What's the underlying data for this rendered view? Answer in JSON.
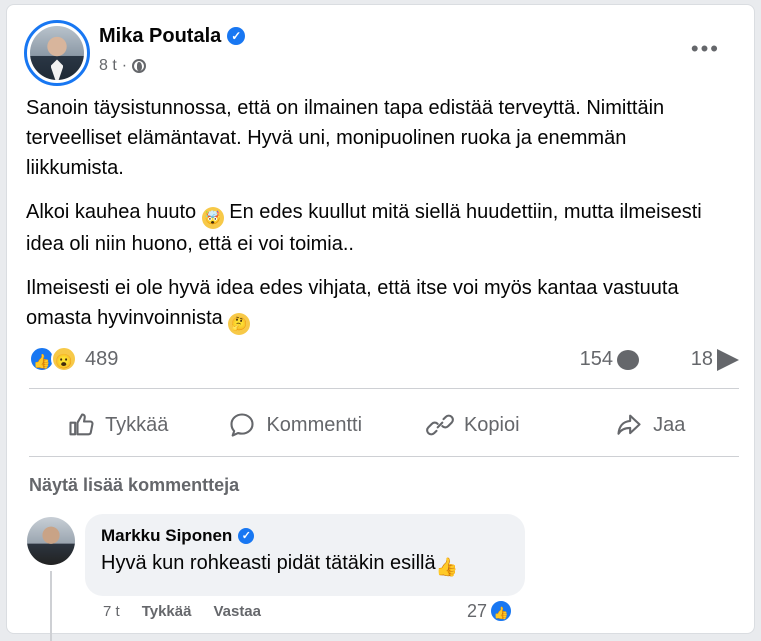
{
  "post": {
    "author": "Mika Poutala",
    "time": "8 t",
    "menu_icon": "more-icon",
    "paragraphs": [
      "Sanoin täysistunnossa, että on ilmainen tapa edistää terveyttä. Nimittäin terveelliset elämäntavat. Hyvä uni, monipuolinen ruoka ja enemmän liikkumista.",
      "Alkoi kauhea huuto",
      "En edes kuullut mitä siellä huudettiin, mutta ilmeisesti idea oli niin huono, että ei voi toimia..",
      "Ilmeisesti ei ole hyvä idea edes vihjata, että itse voi myös kantaa vastuuta omasta hyvinvoinnista"
    ],
    "reaction_count": "489",
    "comment_count": "154",
    "share_count": "18"
  },
  "actions": {
    "like": "Tykkää",
    "comment": "Kommentti",
    "copy": "Kopioi",
    "share": "Jaa"
  },
  "comments": {
    "more_label": "Näytä lisää kommentteja",
    "items": [
      {
        "author": "Markku Siponen",
        "text": "Hyvä kun rohkeasti pidät tätäkin esillä",
        "time": "7 t",
        "like_label": "Tykkää",
        "reply_label": "Vastaa",
        "likes": "27"
      }
    ]
  },
  "colors": {
    "accent": "#1877f2",
    "secondary_text": "#65676b",
    "comment_bg": "#f0f2f5"
  }
}
